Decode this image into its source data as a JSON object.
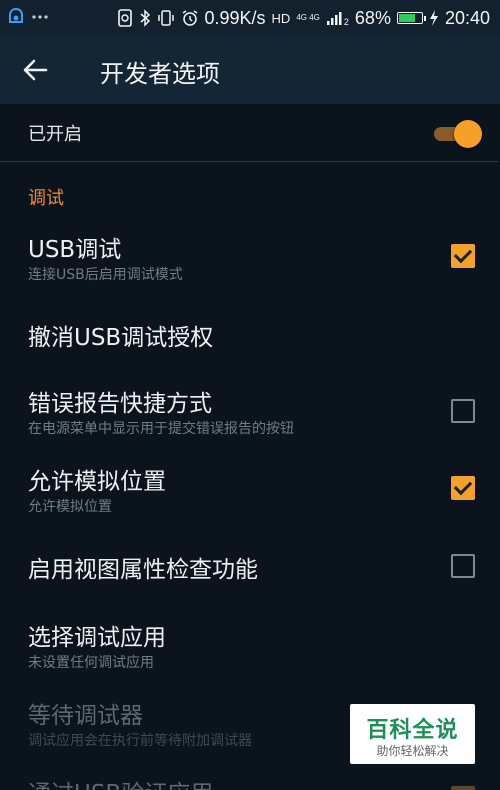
{
  "status_bar": {
    "speed": "0.99K/s",
    "hd": "HD",
    "net_top": "4G 4G",
    "net_sub": "2",
    "battery": "68%",
    "battery_level": 0.68,
    "time": "20:40",
    "icons": [
      "notification-app-icon",
      "more-dots-icon",
      "nfc-icon",
      "bluetooth-icon",
      "vibrate-icon",
      "alarm-icon",
      "signal-icon",
      "battery-icon",
      "charging-icon"
    ]
  },
  "app_bar": {
    "title": "开发者选项"
  },
  "master_switch": {
    "label": "已开启",
    "on": true,
    "accent": "#f6a02a"
  },
  "section": {
    "title": "调试"
  },
  "items": [
    {
      "title": "USB调试",
      "subtitle": "连接USB后启用调试模式",
      "checkbox": "on"
    },
    {
      "title": "撤消USB调试授权",
      "subtitle": "",
      "checkbox": "none"
    },
    {
      "title": "错误报告快捷方式",
      "subtitle": "在电源菜单中显示用于提交错误报告的按钮",
      "checkbox": "off"
    },
    {
      "title": "允许模拟位置",
      "subtitle": "允许模拟位置",
      "checkbox": "on"
    },
    {
      "title": "启用视图属性检查功能",
      "subtitle": "",
      "checkbox": "off"
    },
    {
      "title": "选择调试应用",
      "subtitle": "未设置任何调试应用",
      "checkbox": "none"
    },
    {
      "title": "等待调试器",
      "subtitle": "调试应用会在执行前等待附加调试器",
      "checkbox": "none",
      "disabled": true
    },
    {
      "title": "通过USB验证应用",
      "subtitle": "",
      "checkbox": "partial",
      "disabled": true
    }
  ],
  "watermark": {
    "main": "百科全说",
    "sub": "助你轻松解决"
  }
}
